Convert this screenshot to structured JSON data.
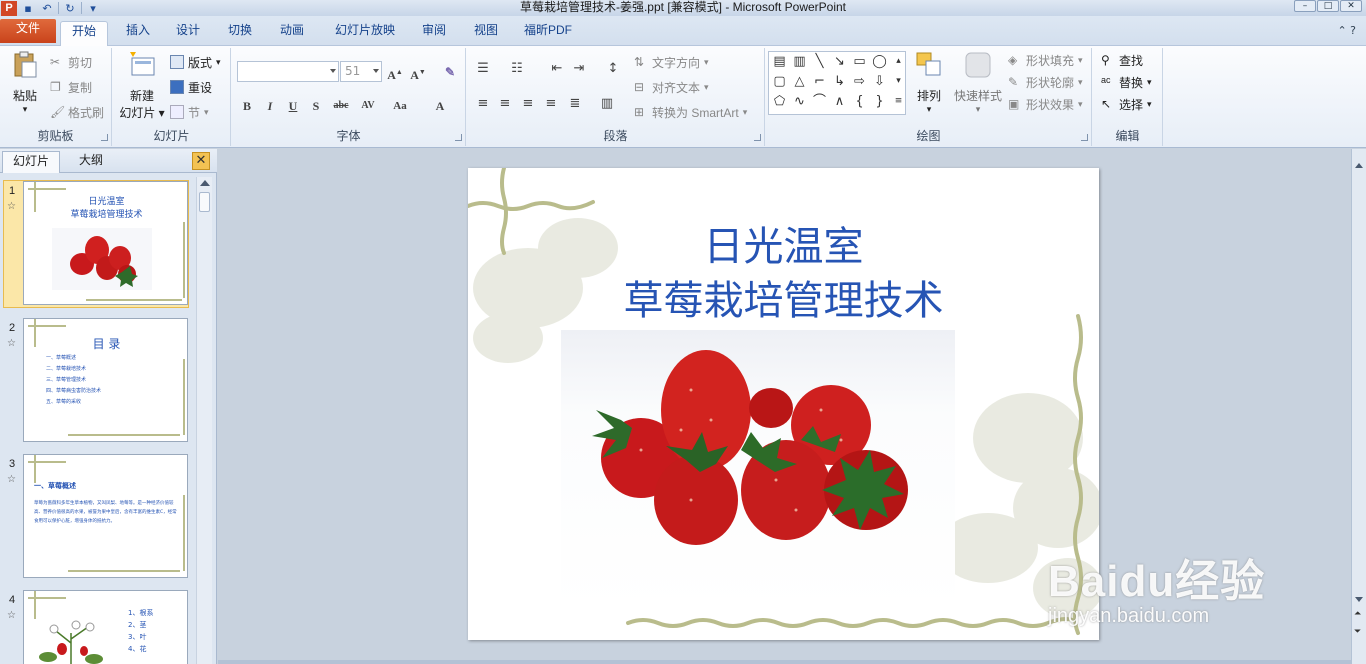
{
  "window": {
    "title": "草莓栽培管理技术-姜强.ppt [兼容模式] - Microsoft PowerPoint",
    "app_icon": "P"
  },
  "tabs": [
    {
      "label": "文件"
    },
    {
      "label": "开始"
    },
    {
      "label": "插入"
    },
    {
      "label": "设计"
    },
    {
      "label": "切换"
    },
    {
      "label": "动画"
    },
    {
      "label": "幻灯片放映"
    },
    {
      "label": "审阅"
    },
    {
      "label": "视图"
    },
    {
      "label": "福昕PDF"
    }
  ],
  "ribbon": {
    "clipboard": {
      "label": "剪贴板",
      "paste": "粘贴",
      "cut": "剪切",
      "copy": "复制",
      "format_painter": "格式刷"
    },
    "slides": {
      "label": "幻灯片",
      "new_slide_1": "新建",
      "new_slide_2": "幻灯片",
      "layout": "版式",
      "reset": "重设",
      "section": "节"
    },
    "font": {
      "label": "字体",
      "font_name": "",
      "font_size": "51"
    },
    "paragraph": {
      "label": "段落",
      "text_direction": "文字方向",
      "align_text": "对齐文本",
      "smartart": "转换为 SmartArt"
    },
    "drawing": {
      "label": "绘图",
      "arrange": "排列",
      "quick_styles": "快速样式",
      "shape_fill": "形状填充",
      "shape_outline": "形状轮廓",
      "shape_effects": "形状效果"
    },
    "editing": {
      "label": "编辑",
      "find": "查找",
      "replace": "替换",
      "select": "选择"
    }
  },
  "pane": {
    "tab_slides": "幻灯片",
    "tab_outline": "大纲",
    "close": "✕",
    "slides": [
      {
        "num": "1",
        "title1": "日光温室",
        "title2": "草莓栽培管理技术"
      },
      {
        "num": "2",
        "title": "目  录",
        "items": [
          "一、草莓概述",
          "二、草莓栽培技术",
          "三、草莓管理技术",
          "四、草莓病虫害防治技术",
          "五、草莓的采收"
        ]
      },
      {
        "num": "3",
        "title": "一、草莓概述",
        "body": "草莓为蔷薇科多年生草本植物，又叫凤梨、地莓等。是一种经济价值较高、营养价值很高的水果，被誉为果中皇后，含有丰富的维生素C，经常食用可以保护心脏，增强身体的抵抗力。"
      },
      {
        "num": "4",
        "items": [
          "1、根系",
          "2、茎",
          "3、叶",
          "4、花"
        ]
      }
    ]
  },
  "slide": {
    "title_line1": "日光温室",
    "title_line2": "草莓栽培管理技术"
  },
  "watermark": {
    "brand": "Baidu经验",
    "url": "jingyan.baidu.com"
  },
  "colors": {
    "file_tab": "#d24726",
    "title_blue": "#2654b4",
    "selected_thumb": "#fbe7a8",
    "vine": "#b9bc8c"
  }
}
